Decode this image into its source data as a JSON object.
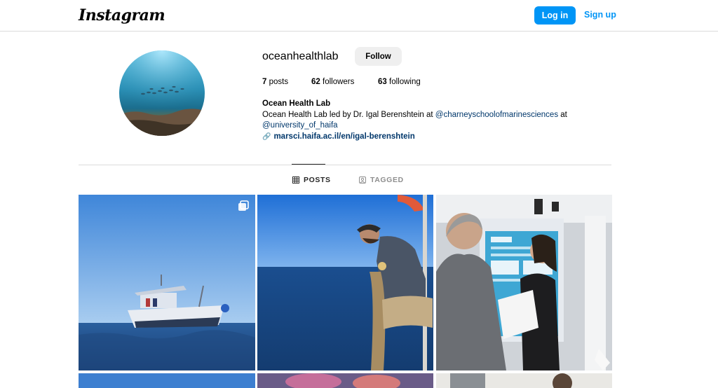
{
  "header": {
    "logo": "Instagram",
    "login_label": "Log in",
    "signup_label": "Sign up"
  },
  "profile": {
    "username": "oceanhealthlab",
    "follow_label": "Follow",
    "stats": {
      "posts_count": "7",
      "posts_label": "posts",
      "followers_count": "62",
      "followers_label": "followers",
      "following_count": "63",
      "following_label": "following"
    },
    "bio": {
      "name": "Ocean Health Lab",
      "line1_prefix": "Ocean Health Lab led by Dr. Igal Berenshtein at ",
      "mention1": "@charneyschoolofmarinesciences",
      "line1_suffix": " at",
      "mention2": "@university_of_haifa",
      "link": "marsci.haifa.ac.il/en/igal-berenshtein"
    }
  },
  "tabs": [
    {
      "label": "POSTS",
      "icon": "grid-icon",
      "active": true
    },
    {
      "label": "TAGGED",
      "icon": "tagged-icon",
      "active": false
    }
  ],
  "colors": {
    "accent": "#0095f6",
    "link": "#00376b",
    "border": "#dbdbdb",
    "button_bg": "#efefef"
  },
  "posts": [
    {
      "subject": "boat-on-sea",
      "multi_image": true
    },
    {
      "subject": "researcher-hauling-net",
      "multi_image": false
    },
    {
      "subject": "poster-session",
      "multi_image": false
    },
    {
      "subject": "partial-row-1",
      "multi_image": false
    },
    {
      "subject": "partial-row-2",
      "multi_image": false
    },
    {
      "subject": "partial-row-3",
      "multi_image": false
    }
  ]
}
